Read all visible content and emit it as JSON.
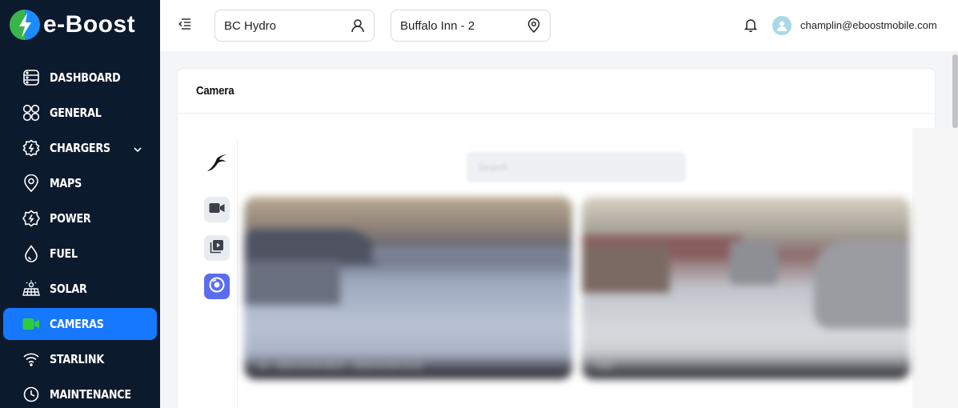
{
  "brand": {
    "name": "e-Boost"
  },
  "sidebar": {
    "items": [
      {
        "label": "DASHBOARD",
        "icon": "dashboard-icon"
      },
      {
        "label": "GENERAL",
        "icon": "grid-circles-icon"
      },
      {
        "label": "CHARGERS",
        "icon": "charger-icon",
        "has_submenu": true
      },
      {
        "label": "MAPS",
        "icon": "map-pin-icon"
      },
      {
        "label": "POWER",
        "icon": "power-gear-icon"
      },
      {
        "label": "FUEL",
        "icon": "fuel-drop-icon"
      },
      {
        "label": "SOLAR",
        "icon": "solar-panel-icon"
      },
      {
        "label": "CAMERAS",
        "icon": "camera-icon",
        "active": true
      },
      {
        "label": "STARLINK",
        "icon": "wifi-icon"
      },
      {
        "label": "MAINTENANCE",
        "icon": "clock-icon"
      }
    ]
  },
  "header": {
    "organization": "BC Hydro",
    "site": "Buffalo Inn - 2",
    "user_email": "champlin@eboostmobile.com"
  },
  "main": {
    "title": "Camera",
    "search_placeholder": "Search",
    "feeds": [
      {
        "caption": "01 - 2024-03-09 08:07 - 2024-03-09 22:21"
      },
      {
        "caption": "Live"
      }
    ]
  },
  "colors": {
    "sidebar_bg": "#0c1a2e",
    "active_accent": "#1677ff",
    "camera_active_green": "#2ecc40",
    "rail_active": "#5b6cf0"
  }
}
